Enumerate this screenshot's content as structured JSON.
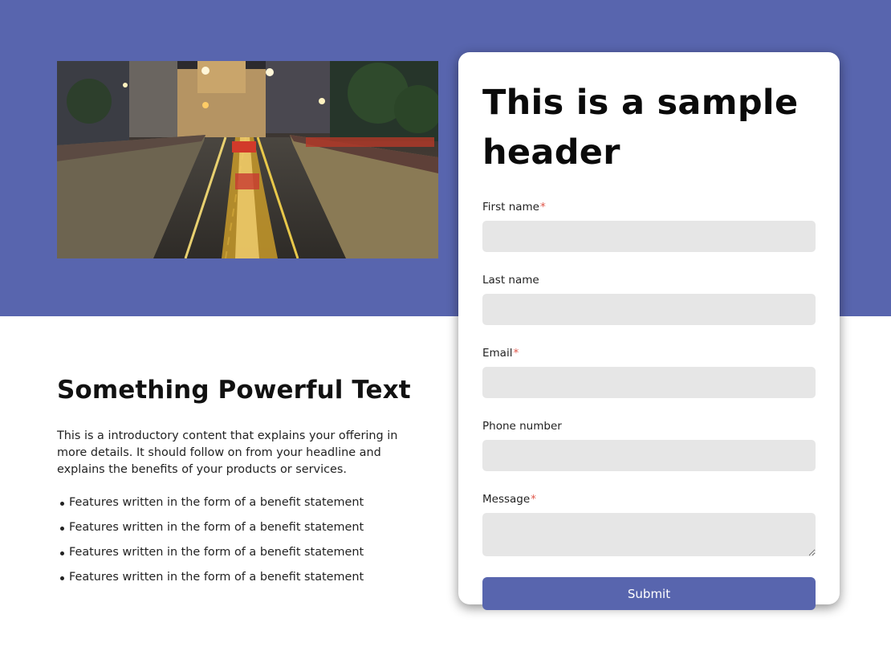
{
  "colors": {
    "brand": "#5865ae",
    "required_marker": "#e0564a",
    "input_background": "#e6e6e6"
  },
  "hero": {
    "image_icon": "city-street-night-photo"
  },
  "content": {
    "heading": "Something Powerful Text",
    "intro": "This is a introductory content that explains your offering in more details. It should follow on from your headline and explains the benefits of your products or services.",
    "features": [
      "Features written in the form of a benefit statement",
      "Features written in the form of a benefit statement",
      "Features written in the form of a benefit statement",
      "Features written in the form of a benefit statement"
    ]
  },
  "form": {
    "title": "This is a sample header",
    "required_mark": "*",
    "fields": {
      "first_name": {
        "label": "First name",
        "value": "",
        "required": true
      },
      "last_name": {
        "label": "Last name",
        "value": "",
        "required": false
      },
      "email": {
        "label": "Email",
        "value": "",
        "required": true
      },
      "phone": {
        "label": "Phone number",
        "value": "",
        "required": false
      },
      "message": {
        "label": "Message",
        "value": "",
        "required": true
      }
    },
    "submit_label": "Submit"
  }
}
